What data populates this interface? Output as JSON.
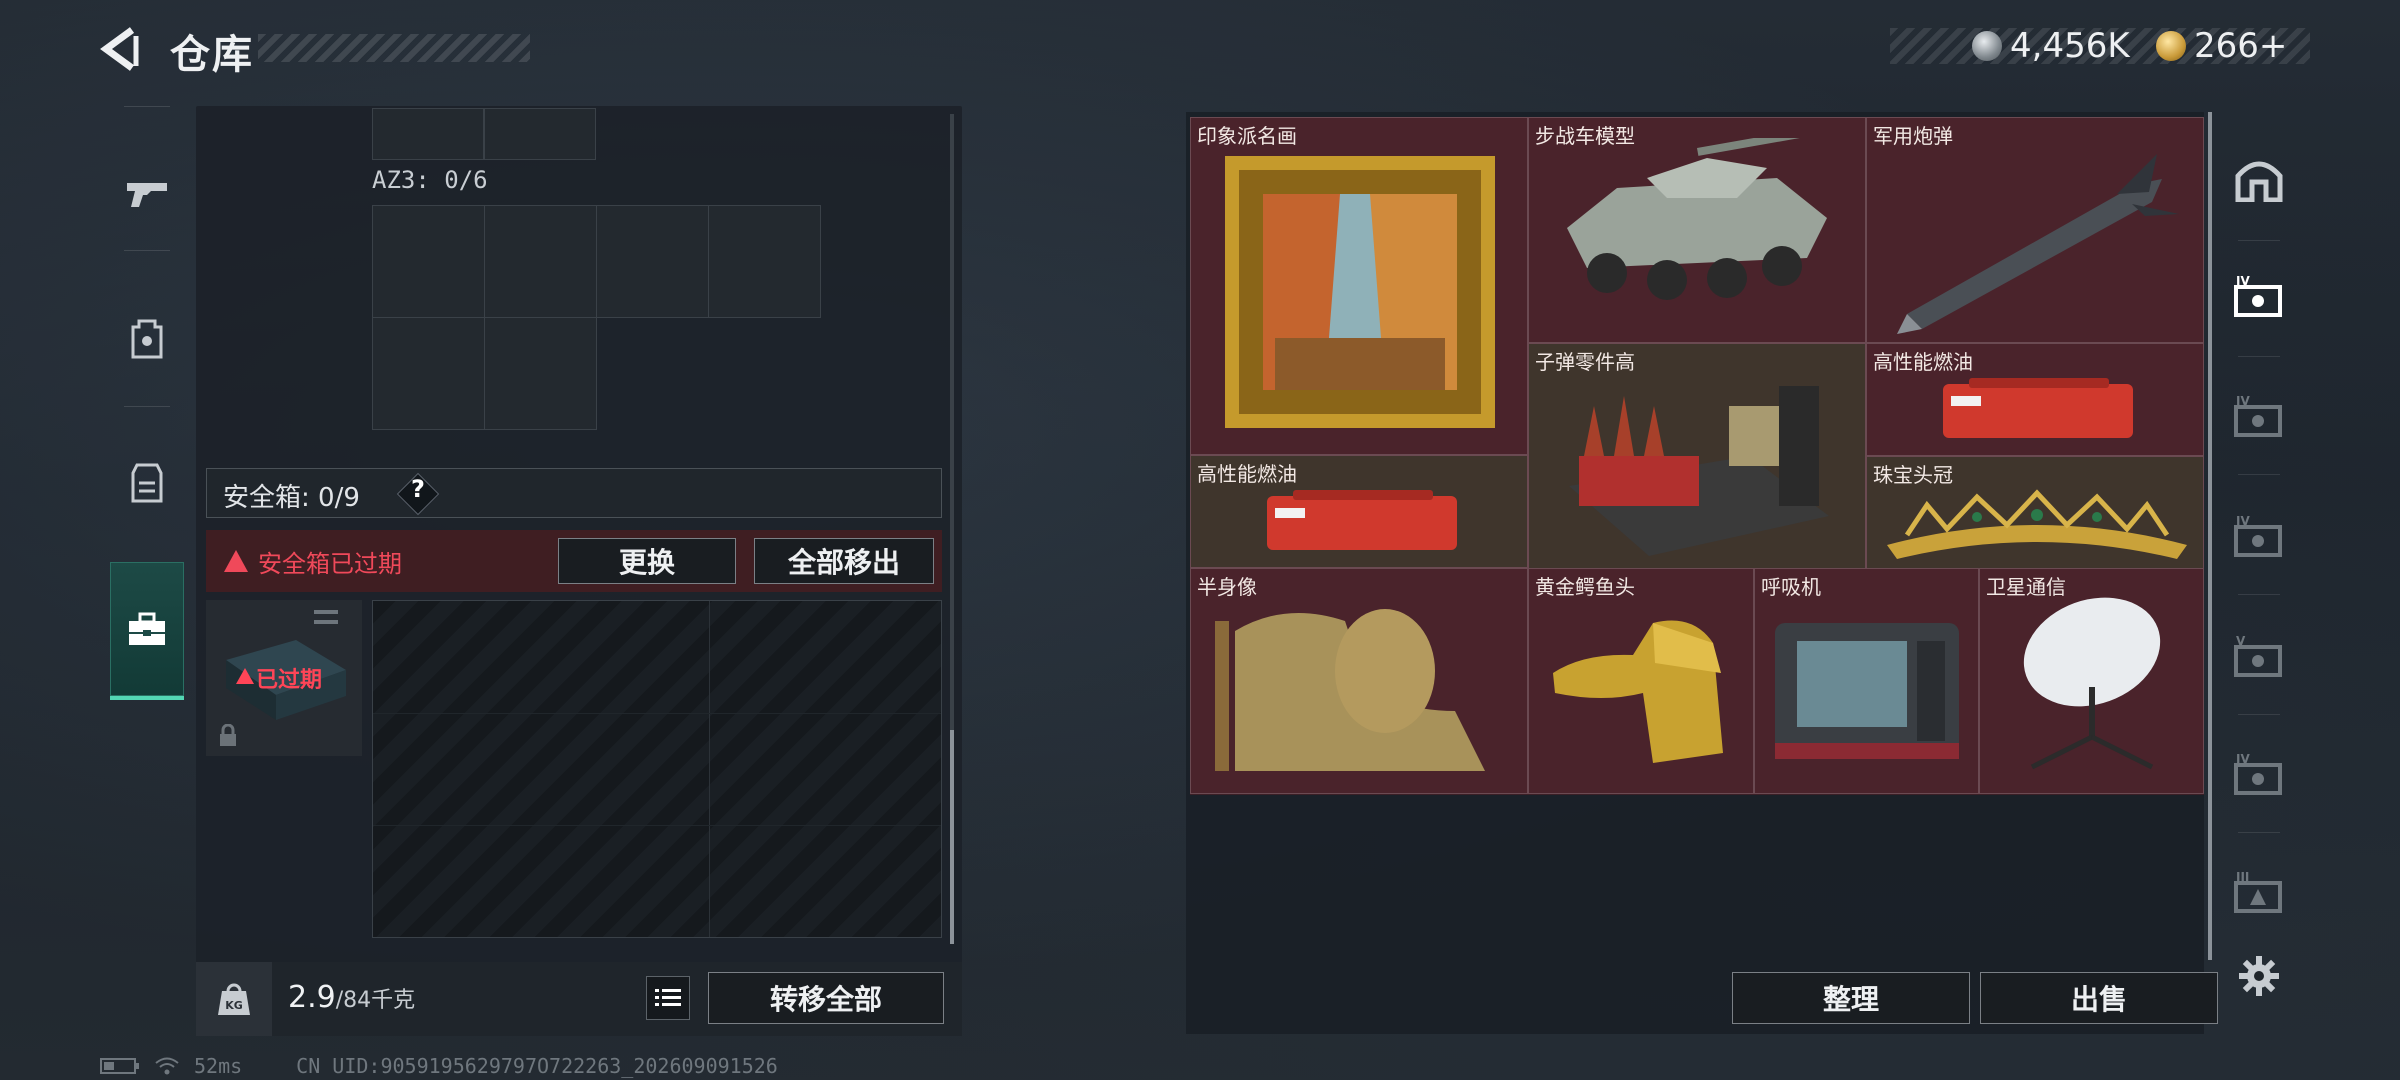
{
  "header": {
    "title": "仓库",
    "currencies": [
      {
        "name": "coin-silver-icon",
        "value": "4,456K"
      },
      {
        "name": "coin-gold-icon",
        "value": "266+"
      }
    ]
  },
  "left_nav": {
    "items": [
      {
        "id": "weapons",
        "icon": "gun-icon"
      },
      {
        "id": "backpack",
        "icon": "backpack-icon"
      },
      {
        "id": "armor",
        "icon": "vest-icon"
      },
      {
        "id": "safebox",
        "icon": "toolbox-icon",
        "active": true
      }
    ]
  },
  "container": {
    "az3_label": "AZ3: 0/6",
    "safebox_label": "安全箱: 0/9",
    "help_label": "?",
    "expired_message": "安全箱已过期",
    "replace_button": "更换",
    "remove_all_button": "全部移出",
    "expired_tag": "已过期"
  },
  "weight": {
    "current": "2.9",
    "max": "/84千克",
    "kg_icon_label": "KG",
    "transfer_all_button": "转移全部"
  },
  "stash": {
    "items": [
      {
        "name": "印象派名画"
      },
      {
        "name": "步战车模型"
      },
      {
        "name": "军用炮弹"
      },
      {
        "name": "子弹零件高"
      },
      {
        "name": "高性能燃油"
      },
      {
        "name": "高性能燃油"
      },
      {
        "name": "珠宝头冠"
      },
      {
        "name": "半身像"
      },
      {
        "name": "黄金鳄鱼头"
      },
      {
        "name": "呼吸机"
      },
      {
        "name": "卫星通信"
      }
    ],
    "sort_button": "整理",
    "sell_button": "出售"
  },
  "right_nav": {
    "items": [
      {
        "icon": "stash-icon",
        "label": ""
      },
      {
        "icon": "case-tier-4-icon",
        "label": "IV",
        "active": true
      },
      {
        "icon": "case-tier-4-icon",
        "label": "IV"
      },
      {
        "icon": "case-tier-4-icon",
        "label": "IV"
      },
      {
        "icon": "case-tier-5-icon",
        "label": "V"
      },
      {
        "icon": "case-tier-4-icon",
        "label": "IV"
      },
      {
        "icon": "case-tier-3-icon",
        "label": "III"
      }
    ],
    "settings_icon": "gear-icon"
  },
  "status": {
    "ping": "52ms",
    "uid": "CN UID:9059195629797O722263_202609091526"
  },
  "colors": {
    "accent": "#53d6b3",
    "warning": "#f0495a",
    "item_bg": "#4a232b"
  }
}
